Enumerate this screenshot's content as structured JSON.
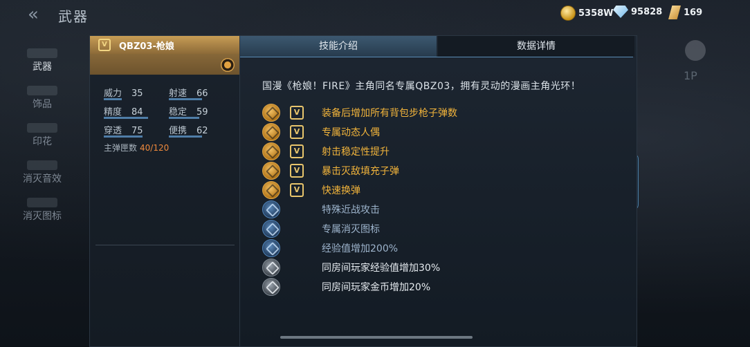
{
  "header": {
    "back_glyph": "«",
    "title": "武器",
    "currencies": [
      {
        "icon": "gold-coin-icon",
        "value": "5358W"
      },
      {
        "icon": "diamond-icon",
        "value": "95828"
      },
      {
        "icon": "ticket-icon",
        "value": "169"
      }
    ]
  },
  "sidebar": {
    "items": [
      {
        "label": "武器",
        "active": true
      },
      {
        "label": "饰品"
      },
      {
        "label": "印花"
      },
      {
        "label": "消灭音效"
      },
      {
        "label": "消灭图标"
      }
    ]
  },
  "weapon": {
    "tier": "V",
    "name": "QBZ03-枪娘",
    "stats": [
      {
        "label": "威力",
        "value": "35"
      },
      {
        "label": "射速",
        "value": "66"
      },
      {
        "label": "精度",
        "value": "84"
      },
      {
        "label": "稳定",
        "value": "59"
      },
      {
        "label": "穿透",
        "value": "75"
      },
      {
        "label": "便携",
        "value": "62"
      }
    ],
    "ammo_label": "主弹匣数",
    "ammo_value": "40/120"
  },
  "tabs": [
    {
      "label": "技能介绍",
      "active": true
    },
    {
      "label": "数据详情",
      "active": false
    }
  ],
  "skills": {
    "intro": "国漫《枪娘！FIRE》主角同名专属QBZ03，拥有灵动的漫画主角光环！",
    "items": [
      {
        "text": "装备后增加所有背包步枪子弹数",
        "icon": "ammo-boost-icon",
        "tier": "V",
        "style": "gold"
      },
      {
        "text": "专属动态人偶",
        "icon": "doll-icon",
        "tier": "V",
        "style": "gold"
      },
      {
        "text": "射击稳定性提升",
        "icon": "stability-icon",
        "tier": "V",
        "style": "gold"
      },
      {
        "text": "暴击灭敌填充子弹",
        "icon": "refill-icon",
        "tier": "V",
        "style": "gold"
      },
      {
        "text": "快速换弹",
        "icon": "reload-icon",
        "tier": "V",
        "style": "gold"
      },
      {
        "text": "特殊近战攻击",
        "icon": "melee-icon",
        "style": "blue"
      },
      {
        "text": "专属消灭图标",
        "icon": "kill-icon",
        "style": "blue"
      },
      {
        "text": "经验值增加200%",
        "icon": "exp-icon",
        "style": "blue"
      },
      {
        "text": "同房间玩家经验值增加30%",
        "icon": "room-exp-icon",
        "style": "white"
      },
      {
        "text": "同房间玩家金币增加20%",
        "icon": "room-coin-icon",
        "style": "white"
      }
    ]
  },
  "colors": {
    "gold_text": "#f2b43b",
    "blue_text": "#9db4cc",
    "ammo_accent": "#f08a3c",
    "stat_bar": "#4f7ea8"
  }
}
